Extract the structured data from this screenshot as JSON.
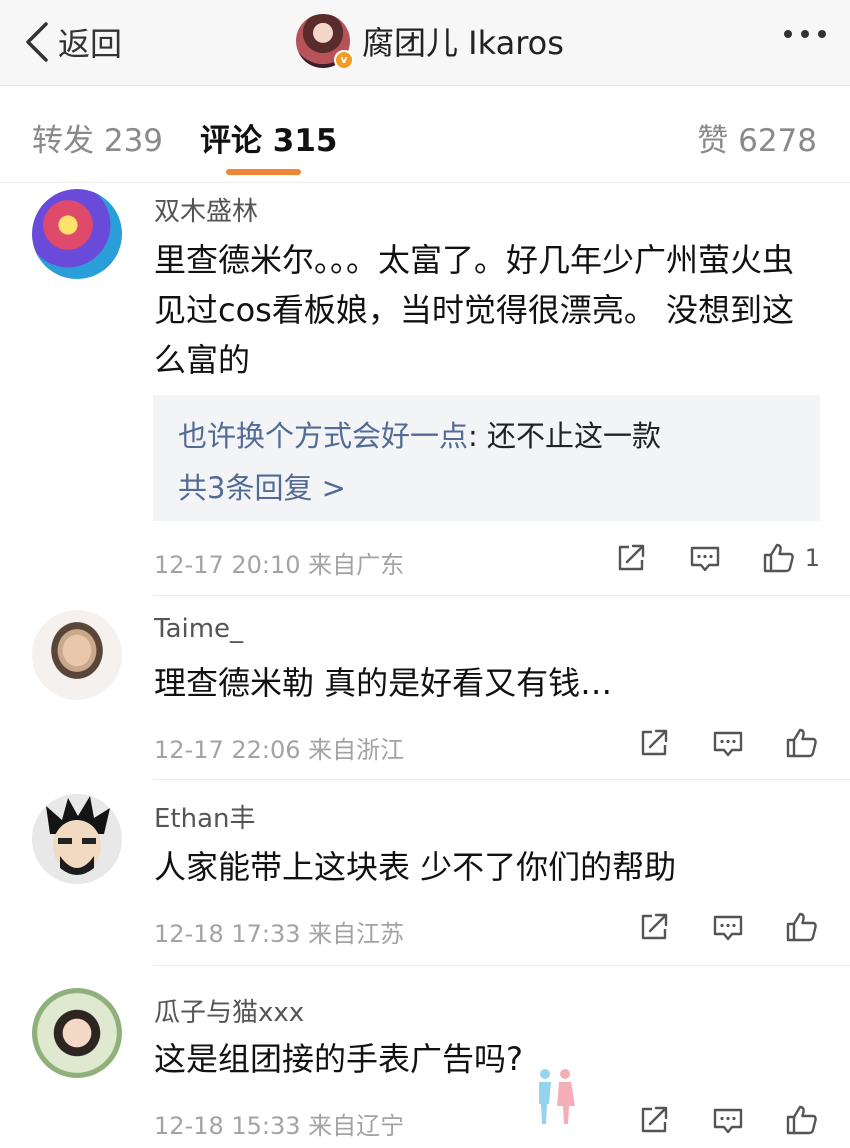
{
  "nav": {
    "back_label": "返回",
    "title": "腐团儿 Ikaros",
    "verified_badge": "v"
  },
  "tabs": {
    "repost": "转发 239",
    "comments": "评论 315",
    "likes": "赞 6278",
    "active": "comments",
    "accent_color": "#f28436"
  },
  "comments": [
    {
      "user": "双木盛林",
      "text": "里查德米尔。。。太富了。好几年少广州萤火虫见过cos看板娘，当时觉得很漂亮。 没想到这么富的",
      "reply_preview": {
        "user": "也许换个方式会好一点",
        "text": ": 还不止这一款"
      },
      "reply_more": "共3条回复 >",
      "time": "12-17 20:10 来自广东",
      "likes": "1"
    },
    {
      "user": "Taime_",
      "text": "理查德米勒 真的是好看又有钱…",
      "time": "12-17 22:06 来自浙江",
      "likes": ""
    },
    {
      "user": "Ethan丰",
      "text": "人家能带上这块表 少不了你们的帮助",
      "time": "12-18 17:33 来自江苏",
      "likes": ""
    },
    {
      "user": "瓜子与猫xxx",
      "text": "这是组团接的手表广告吗?",
      "time": "12-18 15:33 来自辽宁",
      "likes": ""
    }
  ],
  "icons": {
    "back": "chevron-left-icon",
    "more": "more-dots-icon",
    "repost": "share-icon",
    "comment": "comment-icon",
    "like": "thumbs-up-icon"
  },
  "colors": {
    "link": "#516a96",
    "meta": "#a3a3a3"
  }
}
